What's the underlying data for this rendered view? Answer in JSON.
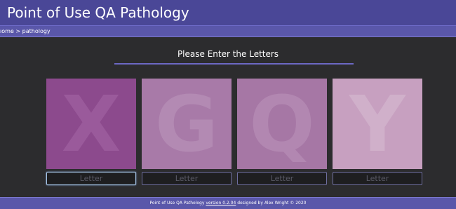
{
  "header": {
    "title": "Point of Use QA Pathology"
  },
  "breadcrumb": {
    "home": "ıome",
    "separator": ">",
    "current": "pathology"
  },
  "main": {
    "prompt": "Please Enter the Letters",
    "cards": [
      {
        "letter": "X",
        "bg_color": "#8c4a8d",
        "letter_color": "#9a5a9b",
        "input_placeholder": "Letter",
        "input_value": ""
      },
      {
        "letter": "G",
        "bg_color": "#a87aa8",
        "letter_color": "#b38ab3",
        "input_placeholder": "Letter",
        "input_value": ""
      },
      {
        "letter": "Q",
        "bg_color": "#a677a5",
        "letter_color": "#b287b1",
        "input_placeholder": "Letter",
        "input_value": ""
      },
      {
        "letter": "Y",
        "bg_color": "#c7a0c0",
        "letter_color": "#d0b0ca",
        "input_placeholder": "Letter",
        "input_value": ""
      }
    ]
  },
  "footer": {
    "text_before": "Point of Use QA Pathology",
    "version_link": "version 0.2.04",
    "text_after": "designed by Alex Wright © 2020"
  },
  "colors": {
    "header_bg": "#4a4797",
    "subbar_bg": "#5a57aa",
    "page_bg": "#2c2c2e",
    "accent_line": "#6c68c4"
  }
}
